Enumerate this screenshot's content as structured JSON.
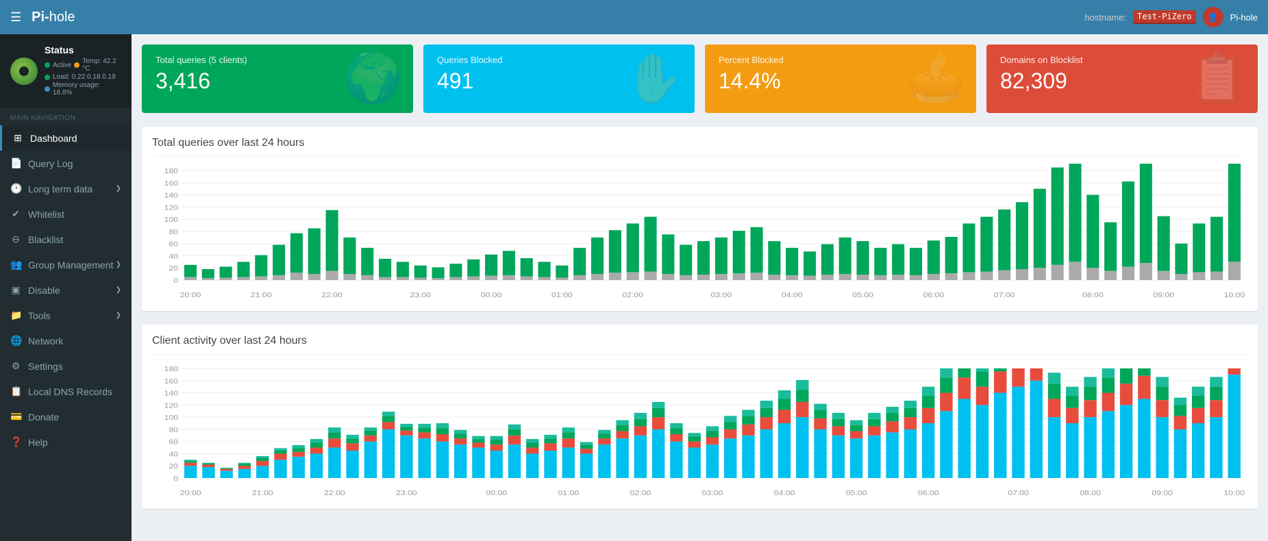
{
  "header": {
    "brand": "Pi-",
    "brand_bold": "hole",
    "hamburger": "☰",
    "hostname_label": "hostname:",
    "hostname_value": "Test-PiZero",
    "user_icon": "👤",
    "username": "Pi-hole"
  },
  "sidebar": {
    "logo_alt": "Pi-hole logo",
    "status": {
      "title": "Status",
      "active_label": "Active",
      "temp_label": "Temp: 42.2 °C",
      "load_label": "Load: 0.22  0.18  0.19",
      "memory_label": "Memory usage: 18.8%"
    },
    "nav_label": "MAIN NAVIGATION",
    "items": [
      {
        "id": "dashboard",
        "icon": "⊞",
        "label": "Dashboard",
        "active": true,
        "has_chevron": false
      },
      {
        "id": "query-log",
        "icon": "📄",
        "label": "Query Log",
        "active": false,
        "has_chevron": false
      },
      {
        "id": "long-term-data",
        "icon": "🕐",
        "label": "Long term data",
        "active": false,
        "has_chevron": true
      },
      {
        "id": "whitelist",
        "icon": "✔",
        "label": "Whitelist",
        "active": false,
        "has_chevron": false
      },
      {
        "id": "blacklist",
        "icon": "⊖",
        "label": "Blacklist",
        "active": false,
        "has_chevron": false
      },
      {
        "id": "group-management",
        "icon": "👥",
        "label": "Group Management",
        "active": false,
        "has_chevron": true
      },
      {
        "id": "disable",
        "icon": "▣",
        "label": "Disable",
        "active": false,
        "has_chevron": true
      },
      {
        "id": "tools",
        "icon": "📁",
        "label": "Tools",
        "active": false,
        "has_chevron": true
      },
      {
        "id": "network",
        "icon": "🌐",
        "label": "Network",
        "active": false,
        "has_chevron": false
      },
      {
        "id": "settings",
        "icon": "⚙",
        "label": "Settings",
        "active": false,
        "has_chevron": false
      },
      {
        "id": "local-dns",
        "icon": "📋",
        "label": "Local DNS Records",
        "active": false,
        "has_chevron": false
      },
      {
        "id": "donate",
        "icon": "💳",
        "label": "Donate",
        "active": false,
        "has_chevron": false
      },
      {
        "id": "help",
        "icon": "❓",
        "label": "Help",
        "active": false,
        "has_chevron": false
      }
    ]
  },
  "cards": [
    {
      "id": "total-queries",
      "color": "card-green",
      "title": "Total queries (5 clients)",
      "value": "3,416",
      "icon": "🌍"
    },
    {
      "id": "queries-blocked",
      "color": "card-blue",
      "title": "Queries Blocked",
      "value": "491",
      "icon": "✋"
    },
    {
      "id": "percent-blocked",
      "color": "card-orange",
      "title": "Percent Blocked",
      "value": "14.4%",
      "icon": "🥧"
    },
    {
      "id": "domains-blocklist",
      "color": "card-red",
      "title": "Domains on Blocklist",
      "value": "82,309",
      "icon": "📋"
    }
  ],
  "chart1": {
    "title": "Total queries over last 24 hours",
    "x_labels": [
      "20:00",
      "21:00",
      "22:00",
      "23:00",
      "00:00",
      "01:00",
      "02:00",
      "03:00",
      "04:00",
      "05:00",
      "06:00",
      "07:00",
      "08:00",
      "09:00",
      "10:00"
    ],
    "y_max": 180,
    "y_labels": [
      0,
      20,
      40,
      60,
      80,
      100,
      120,
      140,
      160,
      180
    ]
  },
  "chart2": {
    "title": "Client activity over last 24 hours",
    "x_labels": [
      "20:00",
      "21:00",
      "22:00",
      "23:00",
      "00:00",
      "01:00",
      "02:00",
      "03:00",
      "04:00",
      "05:00",
      "06:00",
      "07:00",
      "08:00",
      "09:00",
      "10:00"
    ],
    "y_max": 180,
    "y_labels": [
      0,
      20,
      40,
      60,
      80,
      100,
      120,
      140,
      160,
      180
    ]
  },
  "colors": {
    "sidebar_bg": "#222d32",
    "header_bg": "#367fa9",
    "green": "#00a65a",
    "blue_light": "#00c0ef",
    "orange": "#f39c12",
    "red": "#dd4b39",
    "chart_green": "#00a65a",
    "chart_gray": "#aaa",
    "chart_blue": "#00c0ef",
    "chart_red": "#e74c3c",
    "chart_teal": "#1abc9c"
  }
}
